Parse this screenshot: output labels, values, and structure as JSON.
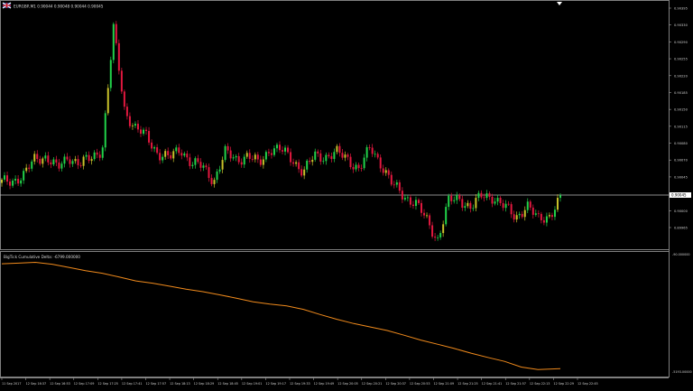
{
  "window": {
    "symbol_line": "EURGBP,M1  0.90044 0.90048 0.90044 0.90045",
    "flag_icon": "uk-flag-icon"
  },
  "indicator": {
    "label": "BigTick Cumulative Delta: -6799.000000"
  },
  "colors": {
    "background": "#000000",
    "frame": "#7f7f7f",
    "bull": "#21d24a",
    "bull_dark": "#c9c22a",
    "bear": "#e2183f",
    "delta_line": "#f08a1c",
    "price_line": "#bdbdbd"
  },
  "price_axis": {
    "ticks": [
      "0.90395",
      "0.90330",
      "0.90290",
      "0.90255",
      "0.90220",
      "0.90185",
      "0.90150",
      "0.90115",
      "0.90080",
      "0.90070",
      "0.90045",
      "0.90030",
      "0.90000",
      "0.89965"
    ],
    "current_price_label": "0.90045"
  },
  "delta_axis": {
    "ticks": [
      "-90.000000",
      "-5193.00000"
    ]
  },
  "time_axis": {
    "ticks": [
      "11 Sep 2017",
      "12 Sep 16:37",
      "12 Sep 16:53",
      "12 Sep 17:09",
      "12 Sep 17:25",
      "12 Sep 17:41",
      "12 Sep 17:57",
      "12 Sep 18:13",
      "12 Sep 18:29",
      "12 Sep 18:45",
      "12 Sep 19:01",
      "12 Sep 19:17",
      "12 Sep 19:33",
      "12 Sep 19:49",
      "12 Sep 20:05",
      "12 Sep 20:21",
      "12 Sep 20:37",
      "12 Sep 20:53",
      "12 Sep 21:09",
      "12 Sep 21:25",
      "12 Sep 21:41",
      "12 Sep 21:57",
      "12 Sep 22:13",
      "12 Sep 22:29",
      "12 Sep 22:45"
    ]
  },
  "chart_data": [
    {
      "type": "line",
      "title": "EURGBP,M1",
      "ylim": [
        0.8996,
        0.904
      ],
      "x": [
        0,
        2,
        4,
        6,
        8,
        10,
        12,
        14,
        16,
        18,
        20,
        22,
        24,
        26,
        28,
        30,
        32,
        34,
        36,
        38,
        40,
        42,
        44,
        46,
        48,
        50,
        52,
        54,
        56,
        58,
        60,
        62,
        64,
        66,
        68,
        70,
        72,
        74,
        76,
        78,
        80,
        82,
        84,
        86,
        88,
        90,
        92,
        94,
        96,
        98,
        100
      ],
      "values": [
        0.90075,
        0.9008,
        0.9009,
        0.9012,
        0.90125,
        0.901,
        0.90125,
        0.9011,
        0.9012,
        0.9014,
        0.9036,
        0.9021,
        0.90175,
        0.9016,
        0.9013,
        0.9012,
        0.9014,
        0.9011,
        0.90105,
        0.9008,
        0.9013,
        0.9012,
        0.90125,
        0.9011,
        0.9014,
        0.90135,
        0.9012,
        0.90095,
        0.90125,
        0.90125,
        0.9013,
        0.9012,
        0.901,
        0.9014,
        0.9011,
        0.9007,
        0.9005,
        0.9004,
        0.90005,
        0.8997,
        0.9004,
        0.90045,
        0.9003,
        0.9005,
        0.9005,
        0.9003,
        0.9001,
        0.90035,
        0.90005,
        0.90015,
        0.90045
      ]
    },
    {
      "type": "line",
      "title": "BigTick Cumulative Delta",
      "ylim": [
        -5300,
        0
      ],
      "x": [
        0,
        3,
        6,
        9,
        12,
        15,
        18,
        21,
        24,
        27,
        30,
        33,
        36,
        39,
        42,
        45,
        48,
        51,
        54,
        57,
        60,
        63,
        66,
        69,
        72,
        75,
        78,
        81,
        84,
        87,
        90,
        93,
        96,
        100
      ],
      "values": [
        -90,
        -60,
        -20,
        -110,
        -260,
        -420,
        -540,
        -720,
        -900,
        -1010,
        -1150,
        -1290,
        -1410,
        -1560,
        -1720,
        -1890,
        -2000,
        -2080,
        -2250,
        -2490,
        -2720,
        -2920,
        -3080,
        -3250,
        -3470,
        -3700,
        -3900,
        -4100,
        -4320,
        -4520,
        -4710,
        -4980,
        -5100,
        -5050
      ]
    }
  ]
}
